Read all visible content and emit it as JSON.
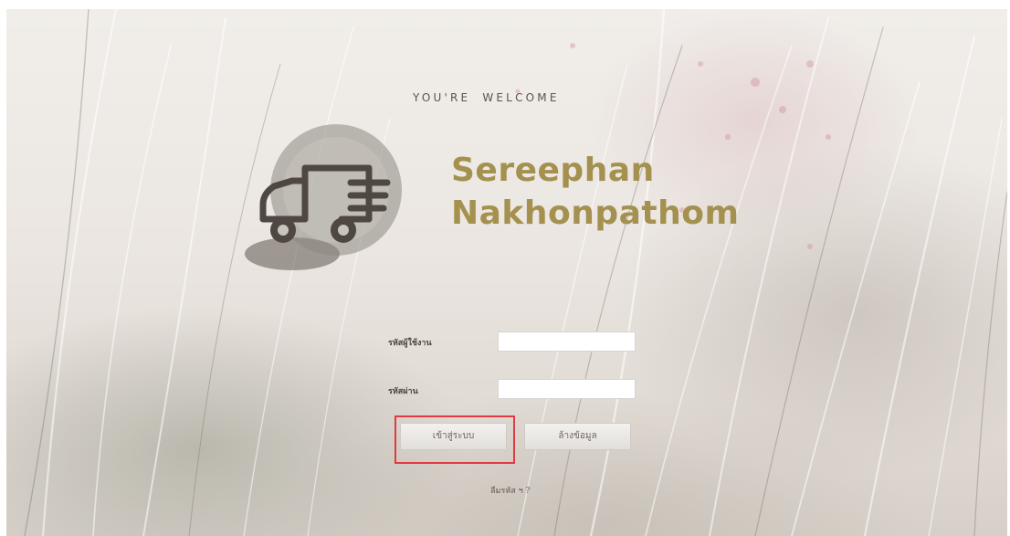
{
  "welcome_text": "YOU'RE  WELCOME",
  "brand": {
    "line1": "Sereephan",
    "line2": "Nakhonpathom",
    "color": "#a4914f"
  },
  "logo": {
    "icon": "delivery-truck-icon"
  },
  "form": {
    "username_label": "รหัสผู้ใช้งาน",
    "username_value": "",
    "password_label": "รหัสผ่าน",
    "password_value": "",
    "login_button": "เข้าสู่ระบบ",
    "cancel_button": "ล้างข้อมูล",
    "forgot_link": "ลืมรหัส ฯ ?"
  },
  "colors": {
    "highlight": "#e13a43",
    "text": "#4e4640"
  }
}
